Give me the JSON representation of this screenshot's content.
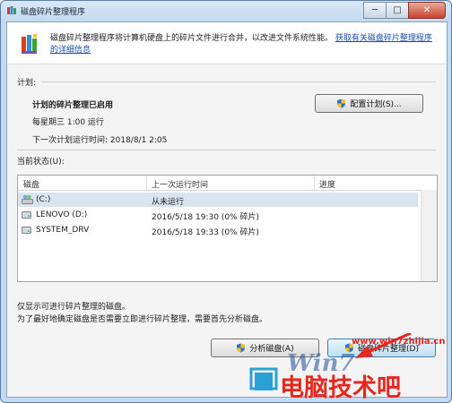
{
  "window": {
    "title": "磁盘碎片整理程序"
  },
  "caption_buttons": {
    "minimize": "─",
    "maximize": "□",
    "close": "✕"
  },
  "icons": {
    "app": "defragmenter-icon",
    "shield": "uac-shield-icon",
    "disk": "hard-disk-icon"
  },
  "header": {
    "description": "磁盘碎片整理程序将计算机硬盘上的碎片文件进行合并，以改进文件系统性能。",
    "link": "获取有关磁盘碎片整理程序的详细信息"
  },
  "schedule": {
    "section_label": "计划:",
    "status_title": "计划的碎片整理已启用",
    "frequency": "每星期三 1:00 运行",
    "next_run": "下一次计划运行时间: 2018/8/1 2:05",
    "configure_button": "配置计划(S)..."
  },
  "current_status": {
    "section_label": "当前状态(U):",
    "columns": [
      "磁盘",
      "上一次运行时间",
      "进度"
    ],
    "rows": [
      {
        "disk": "(C:)",
        "last_run": "从未运行",
        "progress": ""
      },
      {
        "disk": "LENOVO (D:)",
        "last_run": "2016/5/18 19:30 (0% 碎片)",
        "progress": ""
      },
      {
        "disk": "SYSTEM_DRV",
        "last_run": "2016/5/18 19:33 (0% 碎片)",
        "progress": ""
      }
    ]
  },
  "info": {
    "line1": "仅显示可进行碎片整理的磁盘。",
    "line2": "为了最好地确定磁盘是否需要立即进行碎片整理，需要首先分析磁盘。"
  },
  "actions": {
    "analyze": "分析磁盘(A)",
    "defragment": "磁盘碎片整理(D)"
  },
  "watermark": {
    "url": "www.win7zhijia.cn",
    "brand": "电脑技术吧",
    "logo": "Win7"
  },
  "colors": {
    "accent": "#1a4fb0",
    "watermark_red": "#e8261e",
    "selection": "#d9e4f1",
    "close_red": "#c7432c"
  }
}
